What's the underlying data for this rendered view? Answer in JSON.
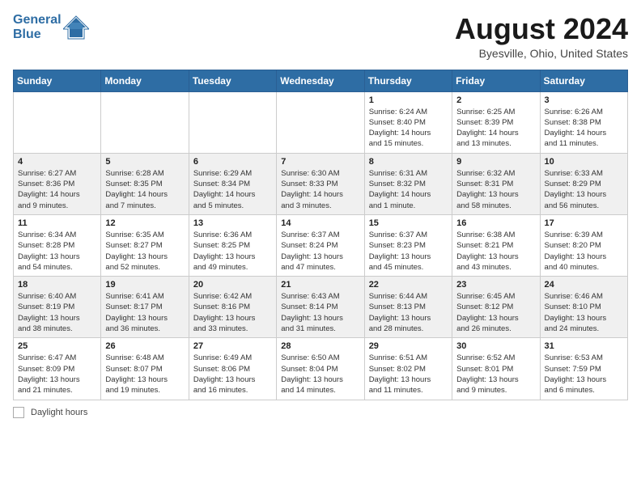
{
  "header": {
    "logo_line1": "General",
    "logo_line2": "Blue",
    "month": "August 2024",
    "location": "Byesville, Ohio, United States"
  },
  "days_of_week": [
    "Sunday",
    "Monday",
    "Tuesday",
    "Wednesday",
    "Thursday",
    "Friday",
    "Saturday"
  ],
  "weeks": [
    [
      {
        "day": "",
        "info": ""
      },
      {
        "day": "",
        "info": ""
      },
      {
        "day": "",
        "info": ""
      },
      {
        "day": "",
        "info": ""
      },
      {
        "day": "1",
        "info": "Sunrise: 6:24 AM\nSunset: 8:40 PM\nDaylight: 14 hours\nand 15 minutes."
      },
      {
        "day": "2",
        "info": "Sunrise: 6:25 AM\nSunset: 8:39 PM\nDaylight: 14 hours\nand 13 minutes."
      },
      {
        "day": "3",
        "info": "Sunrise: 6:26 AM\nSunset: 8:38 PM\nDaylight: 14 hours\nand 11 minutes."
      }
    ],
    [
      {
        "day": "4",
        "info": "Sunrise: 6:27 AM\nSunset: 8:36 PM\nDaylight: 14 hours\nand 9 minutes."
      },
      {
        "day": "5",
        "info": "Sunrise: 6:28 AM\nSunset: 8:35 PM\nDaylight: 14 hours\nand 7 minutes."
      },
      {
        "day": "6",
        "info": "Sunrise: 6:29 AM\nSunset: 8:34 PM\nDaylight: 14 hours\nand 5 minutes."
      },
      {
        "day": "7",
        "info": "Sunrise: 6:30 AM\nSunset: 8:33 PM\nDaylight: 14 hours\nand 3 minutes."
      },
      {
        "day": "8",
        "info": "Sunrise: 6:31 AM\nSunset: 8:32 PM\nDaylight: 14 hours\nand 1 minute."
      },
      {
        "day": "9",
        "info": "Sunrise: 6:32 AM\nSunset: 8:31 PM\nDaylight: 13 hours\nand 58 minutes."
      },
      {
        "day": "10",
        "info": "Sunrise: 6:33 AM\nSunset: 8:29 PM\nDaylight: 13 hours\nand 56 minutes."
      }
    ],
    [
      {
        "day": "11",
        "info": "Sunrise: 6:34 AM\nSunset: 8:28 PM\nDaylight: 13 hours\nand 54 minutes."
      },
      {
        "day": "12",
        "info": "Sunrise: 6:35 AM\nSunset: 8:27 PM\nDaylight: 13 hours\nand 52 minutes."
      },
      {
        "day": "13",
        "info": "Sunrise: 6:36 AM\nSunset: 8:25 PM\nDaylight: 13 hours\nand 49 minutes."
      },
      {
        "day": "14",
        "info": "Sunrise: 6:37 AM\nSunset: 8:24 PM\nDaylight: 13 hours\nand 47 minutes."
      },
      {
        "day": "15",
        "info": "Sunrise: 6:37 AM\nSunset: 8:23 PM\nDaylight: 13 hours\nand 45 minutes."
      },
      {
        "day": "16",
        "info": "Sunrise: 6:38 AM\nSunset: 8:21 PM\nDaylight: 13 hours\nand 43 minutes."
      },
      {
        "day": "17",
        "info": "Sunrise: 6:39 AM\nSunset: 8:20 PM\nDaylight: 13 hours\nand 40 minutes."
      }
    ],
    [
      {
        "day": "18",
        "info": "Sunrise: 6:40 AM\nSunset: 8:19 PM\nDaylight: 13 hours\nand 38 minutes."
      },
      {
        "day": "19",
        "info": "Sunrise: 6:41 AM\nSunset: 8:17 PM\nDaylight: 13 hours\nand 36 minutes."
      },
      {
        "day": "20",
        "info": "Sunrise: 6:42 AM\nSunset: 8:16 PM\nDaylight: 13 hours\nand 33 minutes."
      },
      {
        "day": "21",
        "info": "Sunrise: 6:43 AM\nSunset: 8:14 PM\nDaylight: 13 hours\nand 31 minutes."
      },
      {
        "day": "22",
        "info": "Sunrise: 6:44 AM\nSunset: 8:13 PM\nDaylight: 13 hours\nand 28 minutes."
      },
      {
        "day": "23",
        "info": "Sunrise: 6:45 AM\nSunset: 8:12 PM\nDaylight: 13 hours\nand 26 minutes."
      },
      {
        "day": "24",
        "info": "Sunrise: 6:46 AM\nSunset: 8:10 PM\nDaylight: 13 hours\nand 24 minutes."
      }
    ],
    [
      {
        "day": "25",
        "info": "Sunrise: 6:47 AM\nSunset: 8:09 PM\nDaylight: 13 hours\nand 21 minutes."
      },
      {
        "day": "26",
        "info": "Sunrise: 6:48 AM\nSunset: 8:07 PM\nDaylight: 13 hours\nand 19 minutes."
      },
      {
        "day": "27",
        "info": "Sunrise: 6:49 AM\nSunset: 8:06 PM\nDaylight: 13 hours\nand 16 minutes."
      },
      {
        "day": "28",
        "info": "Sunrise: 6:50 AM\nSunset: 8:04 PM\nDaylight: 13 hours\nand 14 minutes."
      },
      {
        "day": "29",
        "info": "Sunrise: 6:51 AM\nSunset: 8:02 PM\nDaylight: 13 hours\nand 11 minutes."
      },
      {
        "day": "30",
        "info": "Sunrise: 6:52 AM\nSunset: 8:01 PM\nDaylight: 13 hours\nand 9 minutes."
      },
      {
        "day": "31",
        "info": "Sunrise: 6:53 AM\nSunset: 7:59 PM\nDaylight: 13 hours\nand 6 minutes."
      }
    ]
  ],
  "footer": {
    "legend_label": "Daylight hours"
  }
}
